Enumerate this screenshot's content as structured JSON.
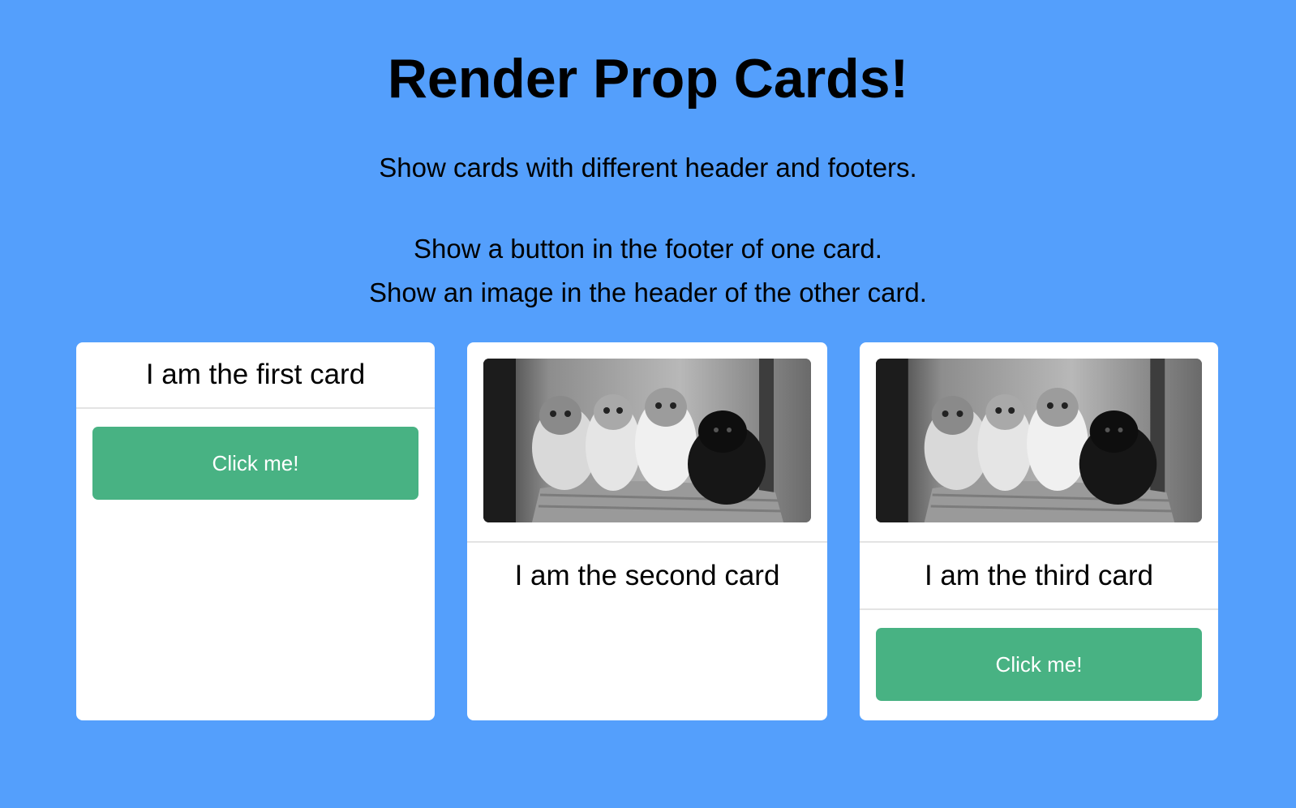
{
  "page": {
    "title": "Render Prop Cards!",
    "intro": "Show cards with different header and footers.",
    "bullets": [
      "Show a button in the footer of one card.",
      "Show an image in the header of the other card."
    ]
  },
  "cards": [
    {
      "title": "I am the first card",
      "button_label": "Click me!"
    },
    {
      "title": "I am the second card"
    },
    {
      "title": "I am the third card",
      "button_label": "Click me!"
    }
  ],
  "colors": {
    "background": "#549ffc",
    "card": "#ffffff",
    "button": "#48b283",
    "button_text": "#ffffff",
    "divider": "#e3e3e3"
  }
}
